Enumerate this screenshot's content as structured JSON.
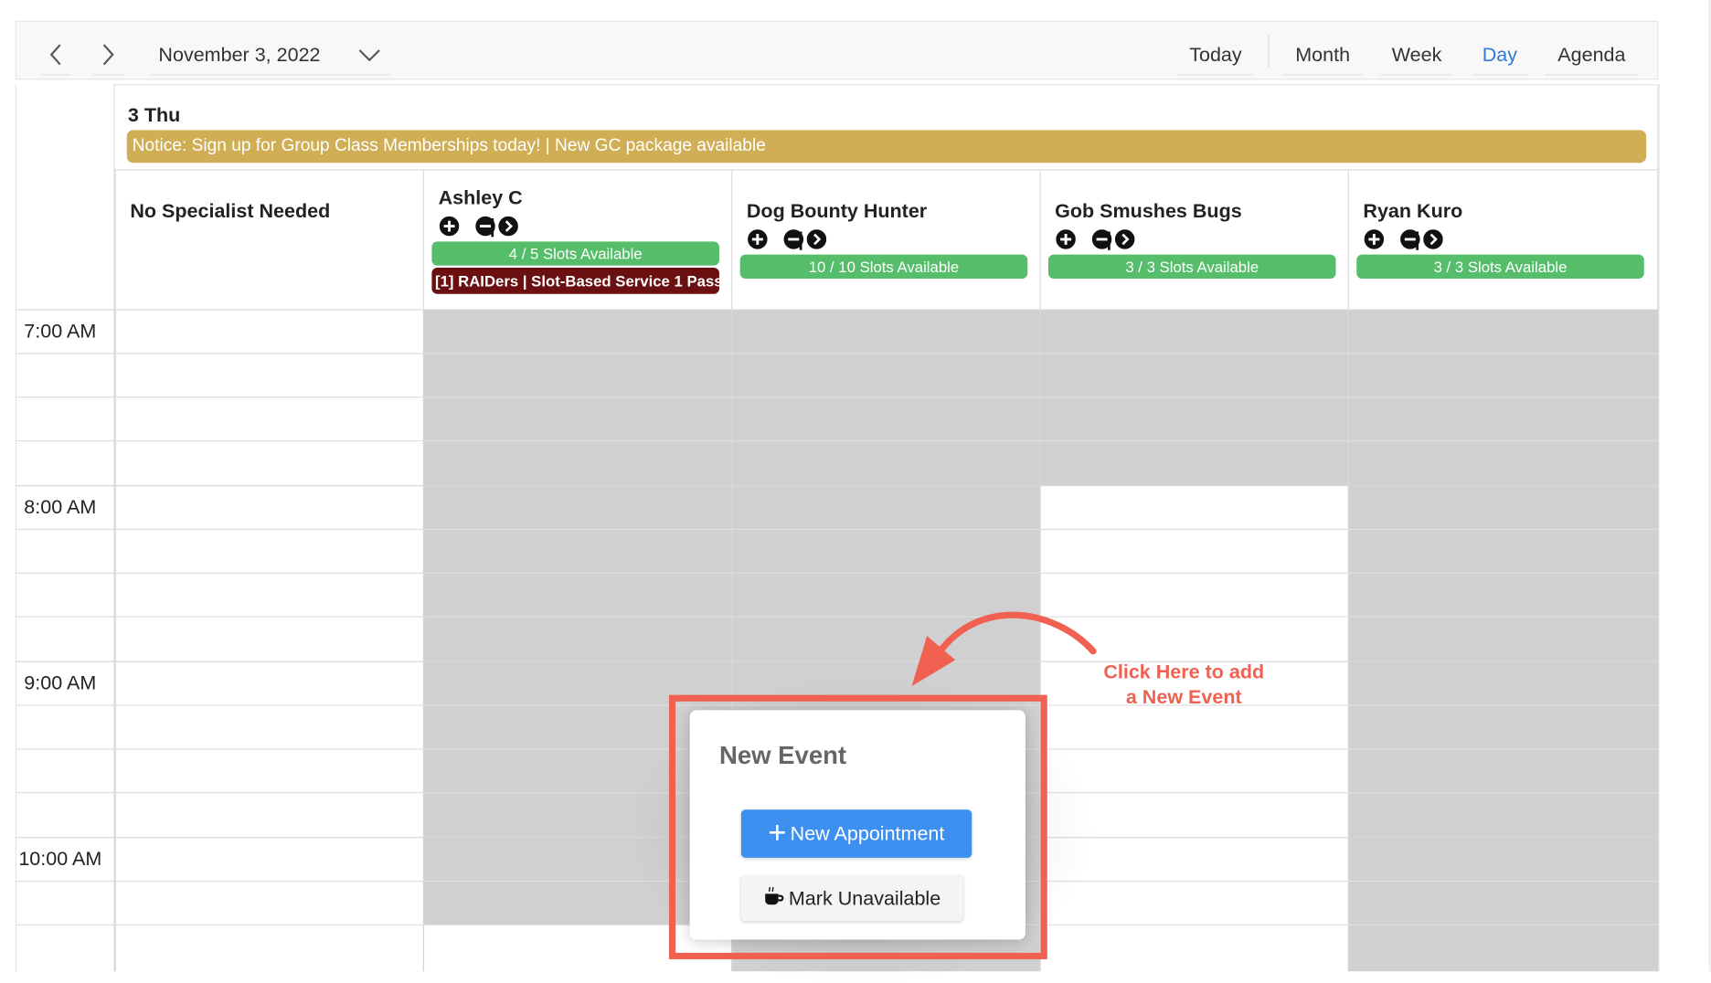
{
  "toolbar": {
    "date": "November 3, 2022",
    "views": {
      "today": "Today",
      "month": "Month",
      "week": "Week",
      "day": "Day",
      "agenda": "Agenda"
    },
    "active_view": "Day"
  },
  "day": {
    "label": "3 Thu",
    "notice": "Notice: Sign up for Group Class Memberships today! | New GC package available",
    "notice_color": "#cfae56"
  },
  "resources": [
    {
      "name": "No Specialist Needed"
    },
    {
      "name": "Ashley C",
      "ctrl_sep": "|",
      "slots": "4 / 5 Slots Available",
      "service": "[1] RAIDers | Slot-Based Service 1 Pass"
    },
    {
      "name": "Dog Bounty Hunter",
      "ctrl_sep": "|",
      "slots": "10 / 10 Slots Available"
    },
    {
      "name": "Gob Smushes Bugs",
      "ctrl_sep": "|",
      "slots": "3 / 3 Slots Available"
    },
    {
      "name": "Ryan Kuro",
      "ctrl_sep": "|",
      "slots": "3 / 3 Slots Available"
    }
  ],
  "times": [
    "7:00 AM",
    "8:00 AM",
    "9:00 AM",
    "10:00 AM"
  ],
  "popup": {
    "title": "New Event",
    "new_appointment": "New Appointment",
    "mark_unavailable": "Mark Unavailable"
  },
  "callout": {
    "line1": "Click Here to add",
    "line2": "a New Event"
  },
  "colors": {
    "slots_green": "#56be6a",
    "service_maroon": "#6a1010",
    "unavailable_gray": "#d0d0d0",
    "primary_blue": "#3d8ff0",
    "callout_red": "#f06152",
    "active_view_blue": "#2f7ad6"
  }
}
